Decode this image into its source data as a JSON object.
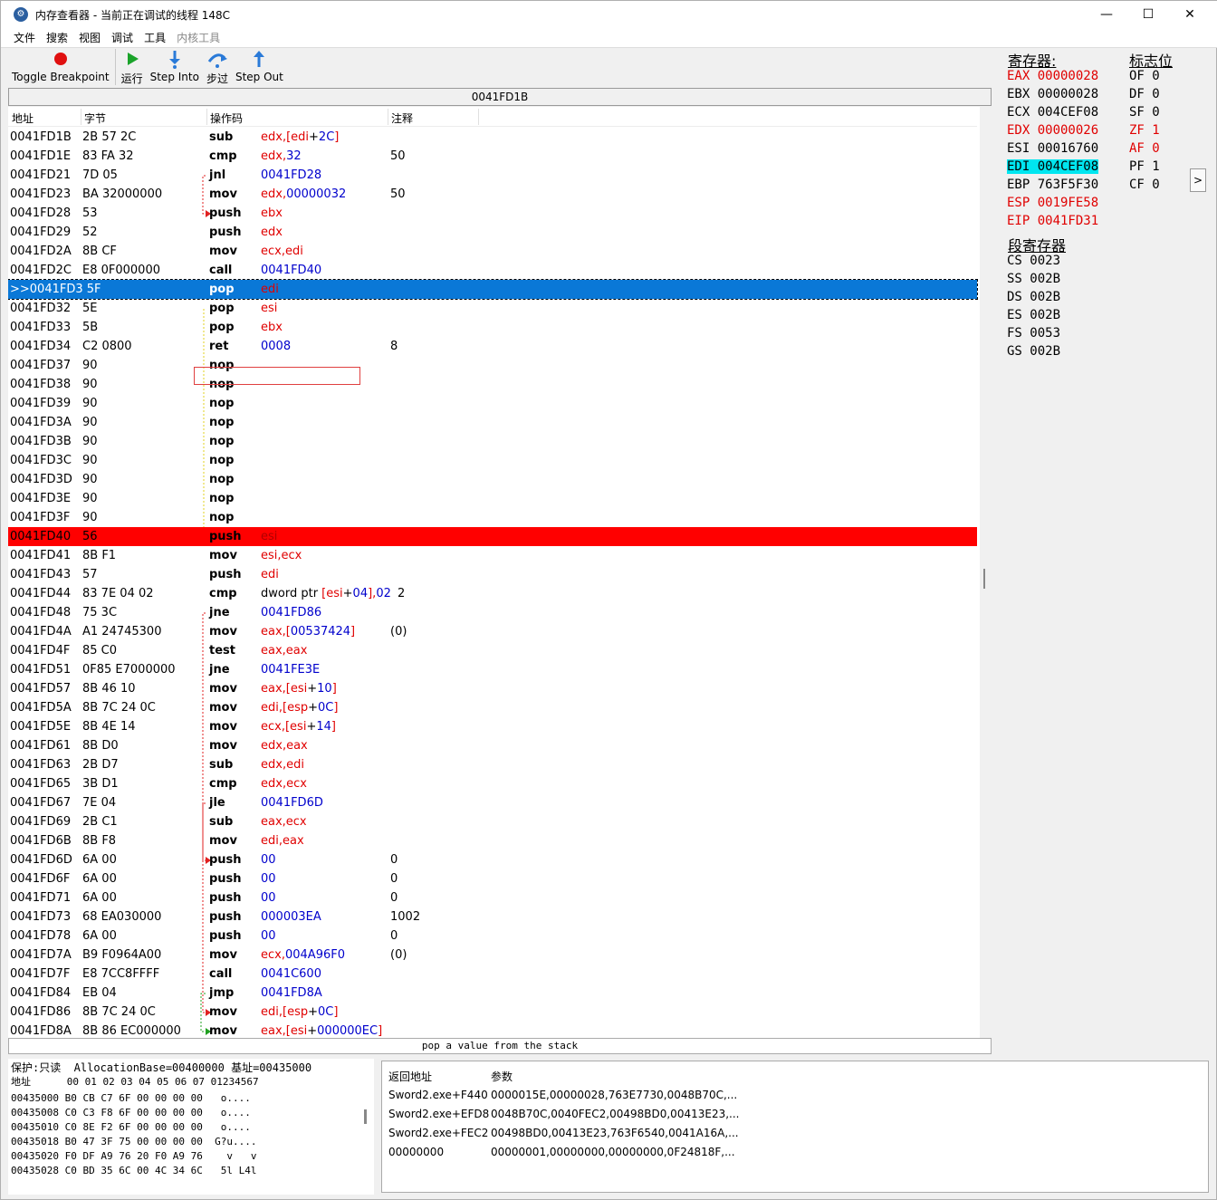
{
  "window": {
    "title": "内存查看器 - 当前正在调试的线程 148C",
    "minimize": "—",
    "maximize": "☐",
    "close": "✕",
    "icon": "app-icon"
  },
  "menu": [
    "文件",
    "搜索",
    "视图",
    "调试",
    "工具",
    "内核工具"
  ],
  "toolbar": {
    "toggle_breakpoint": "Toggle Breakpoint",
    "run": "运行",
    "step_into": "Step Into",
    "step_over": "步过",
    "step_out": "Step Out"
  },
  "address_bar": "0041FD1B",
  "columns": {
    "address": "地址",
    "bytes": "字节",
    "opcode": "操作码",
    "comment": "注释"
  },
  "rows": [
    {
      "addr": "0041FD1B",
      "bytes": "2B 57 2C",
      "op": "sub",
      "args": [
        [
          "edx,[edi",
          "r"
        ],
        [
          "+",
          "k"
        ],
        [
          "2C",
          "b"
        ],
        [
          "]",
          "r"
        ]
      ],
      "cmt": ""
    },
    {
      "addr": "0041FD1E",
      "bytes": "83 FA 32",
      "op": "cmp",
      "args": [
        [
          "edx,",
          "r"
        ],
        [
          "32",
          "b"
        ]
      ],
      "cmt": "50"
    },
    {
      "addr": "0041FD21",
      "bytes": "7D 05",
      "op": "jnl",
      "args": [
        [
          "0041FD28",
          "b"
        ]
      ],
      "cmt": ""
    },
    {
      "addr": "0041FD23",
      "bytes": "BA 32000000",
      "op": "mov",
      "args": [
        [
          "edx,",
          "r"
        ],
        [
          "00000032",
          "b"
        ]
      ],
      "cmt": "50"
    },
    {
      "addr": "0041FD28",
      "bytes": "53",
      "op": "push",
      "args": [
        [
          "ebx",
          "r"
        ]
      ],
      "cmt": ""
    },
    {
      "addr": "0041FD29",
      "bytes": "52",
      "op": "push",
      "args": [
        [
          "edx",
          "r"
        ]
      ],
      "cmt": ""
    },
    {
      "addr": "0041FD2A",
      "bytes": "8B CF",
      "op": "mov",
      "args": [
        [
          "ecx,edi",
          "r"
        ]
      ],
      "cmt": ""
    },
    {
      "addr": "0041FD2C",
      "bytes": "E8 0F000000",
      "op": "call",
      "args": [
        [
          "0041FD40",
          "b"
        ]
      ],
      "cmt": ""
    },
    {
      "addr": ">>0041FD3 5F",
      "bytes": "",
      "op": "pop",
      "args": [
        [
          "edi",
          "r"
        ]
      ],
      "cmt": "",
      "state": "sel"
    },
    {
      "addr": "0041FD32",
      "bytes": "5E",
      "op": "pop",
      "args": [
        [
          "esi",
          "r"
        ]
      ],
      "cmt": ""
    },
    {
      "addr": "0041FD33",
      "bytes": "5B",
      "op": "pop",
      "args": [
        [
          "ebx",
          "r"
        ]
      ],
      "cmt": ""
    },
    {
      "addr": "0041FD34",
      "bytes": "C2 0800",
      "op": "ret",
      "args": [
        [
          "0008",
          "b"
        ]
      ],
      "cmt": "8"
    },
    {
      "addr": "0041FD37",
      "bytes": "90",
      "op": "nop",
      "args": [],
      "cmt": ""
    },
    {
      "addr": "0041FD38",
      "bytes": "90",
      "op": "nop",
      "args": [],
      "cmt": ""
    },
    {
      "addr": "0041FD39",
      "bytes": "90",
      "op": "nop",
      "args": [],
      "cmt": ""
    },
    {
      "addr": "0041FD3A",
      "bytes": "90",
      "op": "nop",
      "args": [],
      "cmt": ""
    },
    {
      "addr": "0041FD3B",
      "bytes": "90",
      "op": "nop",
      "args": [],
      "cmt": ""
    },
    {
      "addr": "0041FD3C",
      "bytes": "90",
      "op": "nop",
      "args": [],
      "cmt": ""
    },
    {
      "addr": "0041FD3D",
      "bytes": "90",
      "op": "nop",
      "args": [],
      "cmt": ""
    },
    {
      "addr": "0041FD3E",
      "bytes": "90",
      "op": "nop",
      "args": [],
      "cmt": ""
    },
    {
      "addr": "0041FD3F",
      "bytes": "90",
      "op": "nop",
      "args": [],
      "cmt": ""
    },
    {
      "addr": "0041FD40",
      "bytes": "56",
      "op": "push",
      "args": [
        [
          "esi",
          "r"
        ]
      ],
      "cmt": "",
      "state": "bp"
    },
    {
      "addr": "0041FD41",
      "bytes": "8B F1",
      "op": "mov",
      "args": [
        [
          "esi,ecx",
          "r"
        ]
      ],
      "cmt": ""
    },
    {
      "addr": "0041FD43",
      "bytes": "57",
      "op": "push",
      "args": [
        [
          "edi",
          "r"
        ]
      ],
      "cmt": ""
    },
    {
      "addr": "0041FD44",
      "bytes": "83 7E 04 02",
      "op": "cmp",
      "args": [
        [
          "dword ptr ",
          "k"
        ],
        [
          "[esi",
          "r"
        ],
        [
          "+",
          "k"
        ],
        [
          "04",
          "b"
        ],
        [
          "],",
          "r"
        ],
        [
          "02",
          "b"
        ]
      ],
      "cmt": "2",
      "cmt_left": true
    },
    {
      "addr": "0041FD48",
      "bytes": "75 3C",
      "op": "jne",
      "args": [
        [
          "0041FD86",
          "b"
        ]
      ],
      "cmt": ""
    },
    {
      "addr": "0041FD4A",
      "bytes": "A1 24745300",
      "op": "mov",
      "args": [
        [
          "eax,[",
          "r"
        ],
        [
          "00537424",
          "b"
        ],
        [
          "]",
          "r"
        ]
      ],
      "cmt": "(0)"
    },
    {
      "addr": "0041FD4F",
      "bytes": "85 C0",
      "op": "test",
      "args": [
        [
          "eax,eax",
          "r"
        ]
      ],
      "cmt": ""
    },
    {
      "addr": "0041FD51",
      "bytes": "0F85 E7000000",
      "op": "jne",
      "args": [
        [
          "0041FE3E",
          "b"
        ]
      ],
      "cmt": ""
    },
    {
      "addr": "0041FD57",
      "bytes": "8B 46 10",
      "op": "mov",
      "args": [
        [
          "eax,[esi",
          "r"
        ],
        [
          "+",
          "k"
        ],
        [
          "10",
          "b"
        ],
        [
          "]",
          "r"
        ]
      ],
      "cmt": ""
    },
    {
      "addr": "0041FD5A",
      "bytes": "8B 7C 24 0C",
      "op": "mov",
      "args": [
        [
          "edi,[esp",
          "r"
        ],
        [
          "+",
          "k"
        ],
        [
          "0C",
          "b"
        ],
        [
          "]",
          "r"
        ]
      ],
      "cmt": ""
    },
    {
      "addr": "0041FD5E",
      "bytes": "8B 4E 14",
      "op": "mov",
      "args": [
        [
          "ecx,[esi",
          "r"
        ],
        [
          "+",
          "k"
        ],
        [
          "14",
          "b"
        ],
        [
          "]",
          "r"
        ]
      ],
      "cmt": ""
    },
    {
      "addr": "0041FD61",
      "bytes": "8B D0",
      "op": "mov",
      "args": [
        [
          "edx,eax",
          "r"
        ]
      ],
      "cmt": ""
    },
    {
      "addr": "0041FD63",
      "bytes": "2B D7",
      "op": "sub",
      "args": [
        [
          "edx,edi",
          "r"
        ]
      ],
      "cmt": ""
    },
    {
      "addr": "0041FD65",
      "bytes": "3B D1",
      "op": "cmp",
      "args": [
        [
          "edx,ecx",
          "r"
        ]
      ],
      "cmt": ""
    },
    {
      "addr": "0041FD67",
      "bytes": "7E 04",
      "op": "jle",
      "args": [
        [
          "0041FD6D",
          "b"
        ]
      ],
      "cmt": ""
    },
    {
      "addr": "0041FD69",
      "bytes": "2B C1",
      "op": "sub",
      "args": [
        [
          "eax,ecx",
          "r"
        ]
      ],
      "cmt": ""
    },
    {
      "addr": "0041FD6B",
      "bytes": "8B F8",
      "op": "mov",
      "args": [
        [
          "edi,eax",
          "r"
        ]
      ],
      "cmt": ""
    },
    {
      "addr": "0041FD6D",
      "bytes": "6A 00",
      "op": "push",
      "args": [
        [
          "00",
          "b"
        ]
      ],
      "cmt": "0"
    },
    {
      "addr": "0041FD6F",
      "bytes": "6A 00",
      "op": "push",
      "args": [
        [
          "00",
          "b"
        ]
      ],
      "cmt": "0"
    },
    {
      "addr": "0041FD71",
      "bytes": "6A 00",
      "op": "push",
      "args": [
        [
          "00",
          "b"
        ]
      ],
      "cmt": "0"
    },
    {
      "addr": "0041FD73",
      "bytes": "68 EA030000",
      "op": "push",
      "args": [
        [
          "000003EA",
          "b"
        ]
      ],
      "cmt": "1002"
    },
    {
      "addr": "0041FD78",
      "bytes": "6A 00",
      "op": "push",
      "args": [
        [
          "00",
          "b"
        ]
      ],
      "cmt": "0"
    },
    {
      "addr": "0041FD7A",
      "bytes": "B9 F0964A00",
      "op": "mov",
      "args": [
        [
          "ecx,",
          "r"
        ],
        [
          "004A96F0",
          "b"
        ]
      ],
      "cmt": "(0)"
    },
    {
      "addr": "0041FD7F",
      "bytes": "E8 7CC8FFFF",
      "op": "call",
      "args": [
        [
          "0041C600",
          "b"
        ]
      ],
      "cmt": ""
    },
    {
      "addr": "0041FD84",
      "bytes": "EB 04",
      "op": "jmp",
      "args": [
        [
          "0041FD8A",
          "b"
        ]
      ],
      "cmt": ""
    },
    {
      "addr": "0041FD86",
      "bytes": "8B 7C 24 0C",
      "op": "mov",
      "args": [
        [
          "edi,[esp",
          "r"
        ],
        [
          "+",
          "k"
        ],
        [
          "0C",
          "b"
        ],
        [
          "]",
          "r"
        ]
      ],
      "cmt": ""
    },
    {
      "addr": "0041FD8A",
      "bytes": "8B 86 EC000000",
      "op": "mov",
      "args": [
        [
          "eax,[esi",
          "r"
        ],
        [
          "+",
          "k"
        ],
        [
          "000000EC",
          "b"
        ],
        [
          "]",
          "r"
        ]
      ],
      "cmt": ""
    }
  ],
  "status": "pop a value from the stack",
  "registers": {
    "title": "寄存器:",
    "list": [
      {
        "name": "EAX",
        "value": "00000028",
        "changed": true
      },
      {
        "name": "EBX",
        "value": "00000028",
        "changed": false
      },
      {
        "name": "ECX",
        "value": "004CEF08",
        "changed": false
      },
      {
        "name": "EDX",
        "value": "00000026",
        "changed": true
      },
      {
        "name": "ESI",
        "value": "00016760",
        "changed": false
      },
      {
        "name": "EDI",
        "value": "004CEF08",
        "changed": false,
        "highlight": true
      },
      {
        "name": "EBP",
        "value": "763F5F30",
        "changed": false
      },
      {
        "name": "ESP",
        "value": "0019FE58",
        "changed": true
      },
      {
        "name": "EIP",
        "value": "0041FD31",
        "changed": true
      }
    ],
    "flags_title": "标志位",
    "flags": [
      {
        "name": "OF",
        "value": "0",
        "changed": false
      },
      {
        "name": "DF",
        "value": "0",
        "changed": false
      },
      {
        "name": "SF",
        "value": "0",
        "changed": false
      },
      {
        "name": "ZF",
        "value": "1",
        "changed": true
      },
      {
        "name": "AF",
        "value": "0",
        "changed": true
      },
      {
        "name": "PF",
        "value": "1",
        "changed": false
      },
      {
        "name": "CF",
        "value": "0",
        "changed": false
      }
    ],
    "seg_title": "段寄存器",
    "segments": [
      {
        "name": "CS",
        "value": "0023"
      },
      {
        "name": "SS",
        "value": "002B"
      },
      {
        "name": "DS",
        "value": "002B"
      },
      {
        "name": "ES",
        "value": "002B"
      },
      {
        "name": "FS",
        "value": "0053"
      },
      {
        "name": "GS",
        "value": "002B"
      }
    ],
    "expand": ">"
  },
  "hex": {
    "info": "保护:只读  AllocationBase=00400000 基址=00435000",
    "header": "地址      00 01 02 03 04 05 06 07 01234567",
    "lines": [
      "00435000 B0 CB C7 6F 00 00 00 00   o....",
      "00435008 C0 C3 F8 6F 00 00 00 00   o....",
      "00435010 C0 8E F2 6F 00 00 00 00   o....",
      "00435018 B0 47 3F 75 00 00 00 00  G?u....",
      "00435020 F0 DF A9 76 20 F0 A9 76    v   v",
      "00435028 C0 BD 35 6C 00 4C 34 6C   5l L4l"
    ]
  },
  "stack": {
    "columns": {
      "ret": "返回地址",
      "params": "参数"
    },
    "rows": [
      {
        "ret": "Sword2.exe+F440",
        "params": "0000015E,00000028,763E7730,0048B70C,..."
      },
      {
        "ret": "Sword2.exe+EFD8",
        "params": "0048B70C,0040FEC2,00498BD0,00413E23,..."
      },
      {
        "ret": "Sword2.exe+FEC2",
        "params": "00498BD0,00413E23,763F6540,0041A16A,..."
      },
      {
        "ret": "00000000",
        "params": "00000001,00000000,00000000,0F24818F,..."
      }
    ]
  }
}
